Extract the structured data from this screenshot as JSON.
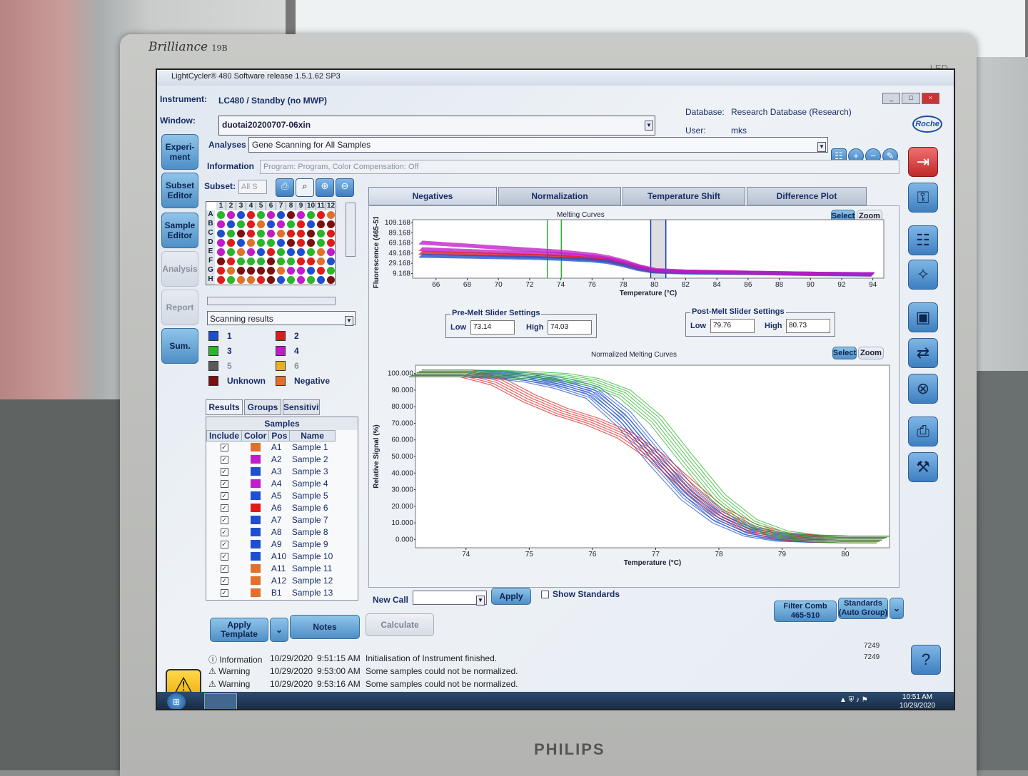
{
  "monitor": {
    "brand": "Brilliance",
    "model": "19B",
    "led": "LED",
    "maker": "PHILIPS"
  },
  "app": {
    "title": "LightCycler® 480 Software release 1.5.1.62 SP3"
  },
  "header": {
    "instrument_label": "Instrument:",
    "instrument_value": "LC480 / Standby (no MWP)",
    "window_label": "Window:",
    "window_value": "duotai20200707-06xin",
    "database_label": "Database:",
    "database_value": "Research Database (Research)",
    "user_label": "User:",
    "user_value": "mks",
    "logo": "Roche"
  },
  "nav": {
    "experiment": "Experi-\nment",
    "subset_editor": "Subset\nEditor",
    "sample_editor": "Sample\nEditor",
    "analysis": "Analysis",
    "report": "Report",
    "sum": "Sum."
  },
  "analyses": {
    "label": "Analyses",
    "value": "Gene Scanning for All Samples",
    "info_label": "Information",
    "info_value": "Program: Program, Color Compensation: Off"
  },
  "subset": {
    "label": "Subset:",
    "value": "All S"
  },
  "plate": {
    "cols": [
      "1",
      "2",
      "3",
      "4",
      "5",
      "6",
      "7",
      "8",
      "9",
      "10",
      "11",
      "12"
    ],
    "rows": [
      "A",
      "B",
      "C",
      "D",
      "E",
      "F",
      "G",
      "H"
    ]
  },
  "scanning": {
    "dropdown": "Scanning results"
  },
  "groups": [
    {
      "label": "1",
      "color": "#1f4fcf"
    },
    {
      "label": "2",
      "color": "#e01b1b"
    },
    {
      "label": "3",
      "color": "#2bb52b"
    },
    {
      "label": "4",
      "color": "#c21bc9"
    },
    {
      "label": "5",
      "color": "#5a5a5a"
    },
    {
      "label": "6",
      "color": "#e8b21a"
    },
    {
      "label": "Unknown",
      "color": "#7a1010"
    },
    {
      "label": "Negative",
      "color": "#e0702a"
    }
  ],
  "subtabs": {
    "results": "Results",
    "groups": "Groups",
    "sensitivity": "Sensitivit"
  },
  "samples": {
    "title": "Samples",
    "headers": [
      "Include",
      "Color",
      "Pos",
      "Name"
    ],
    "rows": [
      {
        "pos": "A1",
        "name": "Sample 1",
        "color": "#e0702a"
      },
      {
        "pos": "A2",
        "name": "Sample 2",
        "color": "#c21bc9"
      },
      {
        "pos": "A3",
        "name": "Sample 3",
        "color": "#1f4fcf"
      },
      {
        "pos": "A4",
        "name": "Sample 4",
        "color": "#c21bc9"
      },
      {
        "pos": "A5",
        "name": "Sample 5",
        "color": "#1f4fcf"
      },
      {
        "pos": "A6",
        "name": "Sample 6",
        "color": "#e01b1b"
      },
      {
        "pos": "A7",
        "name": "Sample 7",
        "color": "#1f4fcf"
      },
      {
        "pos": "A8",
        "name": "Sample 8",
        "color": "#1f4fcf"
      },
      {
        "pos": "A9",
        "name": "Sample 9",
        "color": "#1f4fcf"
      },
      {
        "pos": "A10",
        "name": "Sample 10",
        "color": "#1f4fcf"
      },
      {
        "pos": "A11",
        "name": "Sample 11",
        "color": "#e0702a"
      },
      {
        "pos": "A12",
        "name": "Sample 12",
        "color": "#e0702a"
      },
      {
        "pos": "B1",
        "name": "Sample 13",
        "color": "#e0702a"
      }
    ]
  },
  "bottom_left": {
    "apply_template": "Apply\nTemplate",
    "notes": "Notes",
    "calculate": "Calculate"
  },
  "tabs": [
    "Negatives",
    "Normalization",
    "Temperature Shift",
    "Difference Plot"
  ],
  "melting": {
    "title": "Melting Curves",
    "select": "Select",
    "zoom": "Zoom",
    "ylabel": "Fluorescence (465-510)",
    "xlabel": "Temperature (°C)",
    "yticks": [
      "109.168",
      "89.168",
      "69.168",
      "49.168",
      "29.168",
      "9.168"
    ],
    "xticks": [
      "66",
      "68",
      "70",
      "72",
      "74",
      "76",
      "78",
      "80",
      "82",
      "84",
      "86",
      "88",
      "90",
      "92",
      "94"
    ]
  },
  "premelt": {
    "title": "Pre-Melt Slider Settings",
    "low_label": "Low",
    "low_value": "73.14",
    "high_label": "High",
    "high_value": "74.03"
  },
  "postmelt": {
    "title": "Post-Melt Slider Settings",
    "low_label": "Low",
    "low_value": "79.76",
    "high_label": "High",
    "high_value": "80.73"
  },
  "normalized": {
    "title": "Normalized Melting Curves",
    "select": "Select",
    "zoom": "Zoom",
    "ylabel": "Relative Signal (%)",
    "xlabel": "Temperature (°C)",
    "yticks": [
      "100.000",
      "90.000",
      "80.000",
      "70.000",
      "60.000",
      "50.000",
      "40.000",
      "30.000",
      "20.000",
      "10.000",
      "0.000"
    ],
    "xticks": [
      "74",
      "75",
      "76",
      "77",
      "78",
      "79",
      "80"
    ]
  },
  "chart_data": [
    {
      "type": "line",
      "title": "Melting Curves",
      "xlabel": "Temperature (°C)",
      "ylabel": "Fluorescence (465-510)",
      "xlim": [
        64.5,
        94.7
      ],
      "ylim": [
        0,
        115
      ],
      "x": [
        65,
        72,
        74,
        76,
        77,
        78,
        79,
        80,
        82,
        86,
        90,
        94
      ],
      "series": [
        {
          "values": [
            57,
            49,
            47,
            42,
            38,
            31,
            22,
            15,
            13,
            11,
            9,
            8
          ]
        },
        {
          "values": [
            50,
            44,
            42,
            38,
            35,
            28,
            20,
            14,
            12,
            10,
            9,
            7
          ]
        },
        {
          "values": [
            44,
            40,
            38,
            35,
            32,
            26,
            18,
            13,
            11,
            10,
            8,
            7
          ]
        },
        {
          "values": [
            70,
            56,
            52,
            46,
            41,
            33,
            23,
            16,
            13,
            11,
            9,
            8
          ]
        }
      ]
    },
    {
      "type": "line",
      "title": "Normalized Melting Curves",
      "xlabel": "Temperature (°C)",
      "ylabel": "Relative Signal (%)",
      "xlim": [
        73.2,
        80.7
      ],
      "ylim": [
        -5,
        105
      ],
      "x": [
        73.2,
        74,
        74.5,
        75,
        75.5,
        76,
        76.5,
        77,
        77.5,
        78,
        78.5,
        79,
        79.5,
        80,
        80.6
      ],
      "series": [
        {
          "values": [
            100,
            100,
            99.5,
            98,
            95,
            90,
            75,
            52,
            30,
            14,
            5,
            1.5,
            0.4,
            0,
            0
          ]
        },
        {
          "values": [
            100,
            100,
            99,
            97,
            93,
            87,
            70,
            47,
            26,
            12,
            4,
            1,
            0.3,
            0,
            0
          ]
        },
        {
          "values": [
            100,
            100,
            95,
            85,
            77,
            71,
            63,
            50,
            33,
            17,
            7,
            2,
            0.5,
            0,
            0
          ]
        },
        {
          "values": [
            100,
            100,
            99.8,
            99,
            98,
            95,
            88,
            72,
            48,
            25,
            10,
            3,
            0.7,
            0,
            0
          ]
        }
      ]
    }
  ],
  "newcall": {
    "label": "New Call",
    "apply": "Apply",
    "show_standards": "Show Standards"
  },
  "filter": {
    "filter_comb": "Filter Comb\n465-510",
    "standards": "Standards\n(Auto Group)"
  },
  "log": [
    {
      "type": "Information",
      "date": "10/29/2020",
      "time": "9:51:15 AM",
      "msg": "Initialisation of Instrument finished."
    },
    {
      "type": "Warning",
      "date": "10/29/2020",
      "time": "9:53:00 AM",
      "msg": "Some samples could not be normalized."
    },
    {
      "type": "Warning",
      "date": "10/29/2020",
      "time": "9:53:16 AM",
      "msg": "Some samples could not be normalized."
    }
  ],
  "log_counts": [
    "7249",
    "7249"
  ],
  "tray": {
    "time": "10:51 AM",
    "date": "10/29/2020"
  },
  "colors": {
    "blue": "#1f4fcf",
    "red": "#e01b1b",
    "green": "#2bb52b",
    "purple": "#c21bc9",
    "accent": "#4f8fc6"
  }
}
